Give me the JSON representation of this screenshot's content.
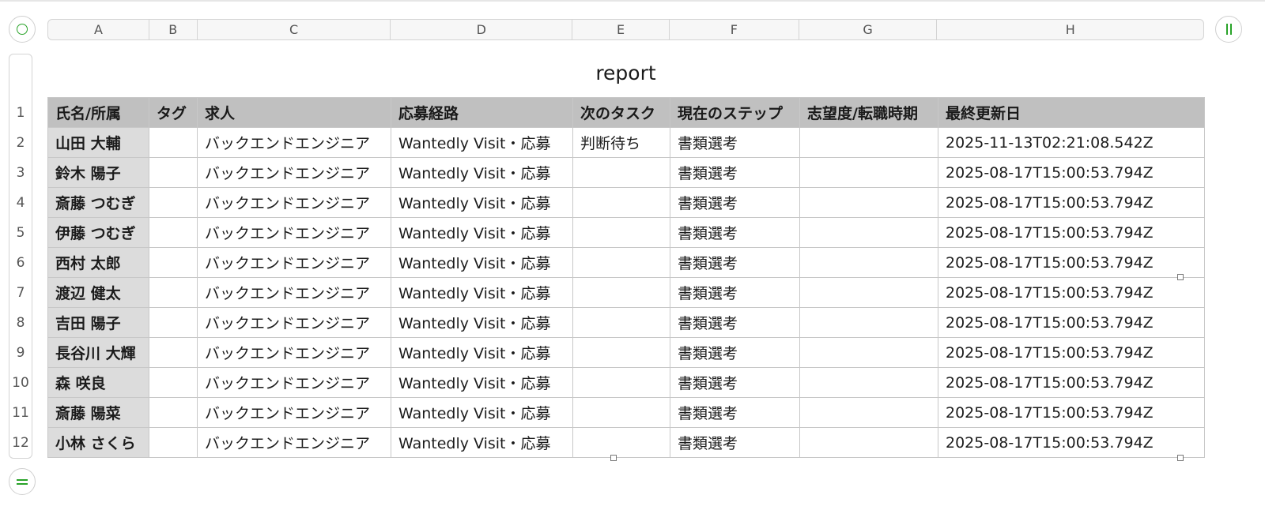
{
  "sheet": {
    "title": "report",
    "column_letters": [
      "A",
      "B",
      "C",
      "D",
      "E",
      "F",
      "G",
      "H"
    ],
    "row_numbers": [
      "1",
      "2",
      "3",
      "4",
      "5",
      "6",
      "7",
      "8",
      "9",
      "10",
      "11",
      "12"
    ],
    "headers": [
      "氏名/所属",
      "タグ",
      "求人",
      "応募経路",
      "次のタスク",
      "現在のステップ",
      "志望度/転職時期",
      "最終更新日"
    ],
    "rows": [
      [
        "山田 大輔",
        "",
        "バックエンドエンジニア",
        "Wantedly Visit・応募",
        "判断待ち",
        "書類選考",
        "",
        "2025-11-13T02:21:08.542Z"
      ],
      [
        "鈴木 陽子",
        "",
        "バックエンドエンジニア",
        "Wantedly Visit・応募",
        "",
        "書類選考",
        "",
        "2025-08-17T15:00:53.794Z"
      ],
      [
        "斎藤 つむぎ",
        "",
        "バックエンドエンジニア",
        "Wantedly Visit・応募",
        "",
        "書類選考",
        "",
        "2025-08-17T15:00:53.794Z"
      ],
      [
        "伊藤 つむぎ",
        "",
        "バックエンドエンジニア",
        "Wantedly Visit・応募",
        "",
        "書類選考",
        "",
        "2025-08-17T15:00:53.794Z"
      ],
      [
        "西村 太郎",
        "",
        "バックエンドエンジニア",
        "Wantedly Visit・応募",
        "",
        "書類選考",
        "",
        "2025-08-17T15:00:53.794Z"
      ],
      [
        "渡辺 健太",
        "",
        "バックエンドエンジニア",
        "Wantedly Visit・応募",
        "",
        "書類選考",
        "",
        "2025-08-17T15:00:53.794Z"
      ],
      [
        "吉田 陽子",
        "",
        "バックエンドエンジニア",
        "Wantedly Visit・応募",
        "",
        "書類選考",
        "",
        "2025-08-17T15:00:53.794Z"
      ],
      [
        "長谷川 大輝",
        "",
        "バックエンドエンジニア",
        "Wantedly Visit・応募",
        "",
        "書類選考",
        "",
        "2025-08-17T15:00:53.794Z"
      ],
      [
        "森 咲良",
        "",
        "バックエンドエンジニア",
        "Wantedly Visit・応募",
        "",
        "書類選考",
        "",
        "2025-08-17T15:00:53.794Z"
      ],
      [
        "斎藤 陽菜",
        "",
        "バックエンドエンジニア",
        "Wantedly Visit・応募",
        "",
        "書類選考",
        "",
        "2025-08-17T15:00:53.794Z"
      ],
      [
        "小林 さくら",
        "",
        "バックエンドエンジニア",
        "Wantedly Visit・応募",
        "",
        "書類選考",
        "",
        "2025-08-17T15:00:53.794Z"
      ]
    ]
  },
  "colors": {
    "accent": "#29a329",
    "header_fill": "#c0c0c0",
    "name_fill": "#dcdcdc"
  },
  "icons": {
    "table_select": "circle-icon",
    "add_column": "pause-bars-icon",
    "add_row": "equals-icon"
  }
}
